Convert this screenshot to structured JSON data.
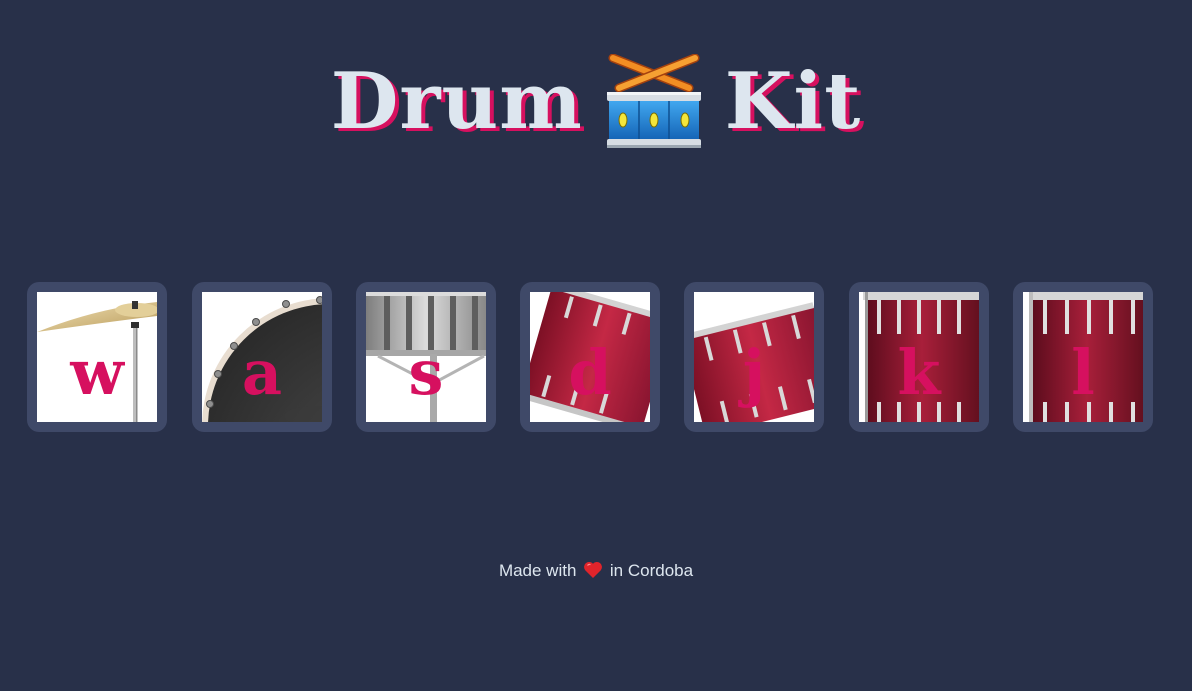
{
  "header": {
    "title_left": "Drum",
    "title_right": "Kit",
    "title_icon": "drum-with-sticks-icon"
  },
  "keys": [
    {
      "letter": "w",
      "instrument": "cymbal-icon"
    },
    {
      "letter": "a",
      "instrument": "bass-drum-icon"
    },
    {
      "letter": "s",
      "instrument": "snare-drum-icon"
    },
    {
      "letter": "d",
      "instrument": "tom-drum-icon"
    },
    {
      "letter": "j",
      "instrument": "tom-drum-icon"
    },
    {
      "letter": "k",
      "instrument": "floor-tom-icon"
    },
    {
      "letter": "l",
      "instrument": "floor-tom-icon"
    }
  ],
  "footer": {
    "prefix": "Made with",
    "suffix": "in Cordoba",
    "icon": "heart-icon"
  },
  "colors": {
    "background": "#283049",
    "key_frame": "#3f4968",
    "accent": "#d6105f",
    "title_text": "#dde6ef"
  }
}
